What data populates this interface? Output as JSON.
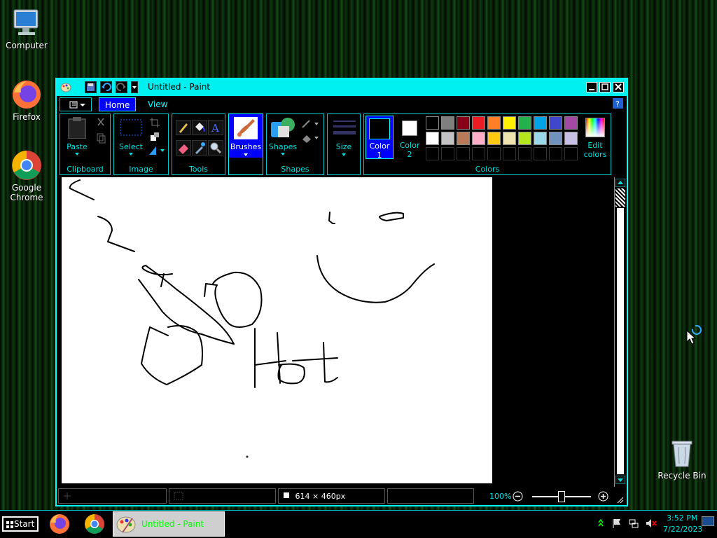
{
  "desktop": {
    "icons": [
      {
        "label": "Computer",
        "icon": "computer-icon"
      },
      {
        "label": "Firefox",
        "icon": "firefox-icon"
      },
      {
        "label": "Google Chrome",
        "icon": "chrome-icon"
      },
      {
        "label": "Recycle Bin",
        "icon": "recycle-bin-icon"
      }
    ]
  },
  "window": {
    "title": "Untitled - Paint",
    "tabs": {
      "menu": "menu-icon",
      "home": "Home",
      "view": "View"
    },
    "colors": {
      "accent": "#00ffff",
      "active_tab": "#0000ff",
      "background": "#000000"
    }
  },
  "ribbon": {
    "clipboard": {
      "group": "Clipboard",
      "paste": "Paste"
    },
    "image": {
      "group": "Image",
      "select": "Select"
    },
    "tools": {
      "group": "Tools"
    },
    "brushes": {
      "label": "Brushes"
    },
    "shapes": {
      "group": "Shapes",
      "label": "Shapes"
    },
    "size": {
      "label": "Size"
    },
    "colors": {
      "group": "Colors",
      "color1_line1": "Color",
      "color1_line2": "1",
      "color2_line1": "Color",
      "color2_line2": "2",
      "edit_line1": "Edit",
      "edit_line2": "colors",
      "palette_row1": [
        "#000000",
        "#7f7f7f",
        "#880015",
        "#ed1c24",
        "#ff7f27",
        "#fff200",
        "#22b14c",
        "#00a2e8",
        "#3f48cc",
        "#a349a4"
      ],
      "palette_row2": [
        "#ffffff",
        "#c3c3c3",
        "#b97a57",
        "#ffaec9",
        "#ffc90e",
        "#efe4b0",
        "#b5e61d",
        "#99d9ea",
        "#7092be",
        "#c8bfe7"
      ]
    }
  },
  "status": {
    "size": "614 × 460px",
    "zoom": "100%"
  },
  "taskbar": {
    "start": "Start",
    "active_app": "Untitled - Paint",
    "time": "3:52 PM",
    "date": "7/22/2023"
  }
}
